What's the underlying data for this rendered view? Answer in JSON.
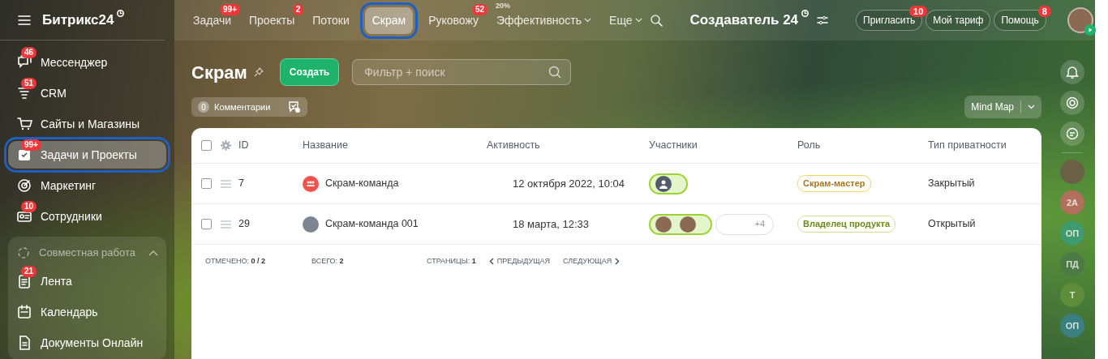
{
  "header": {
    "logo": "Битрикс24",
    "nav_tabs": [
      {
        "label": "Задачи",
        "badge": "99+",
        "selected": false,
        "dropdown": false
      },
      {
        "label": "Проекты",
        "badge": "2",
        "selected": false,
        "dropdown": false
      },
      {
        "label": "Потоки",
        "selected": false,
        "dropdown": false
      },
      {
        "label": "Скрам",
        "selected": true,
        "dropdown": false
      },
      {
        "label": "Руковожу",
        "badge": "52",
        "selected": false,
        "dropdown": false
      },
      {
        "label": "Эффективность",
        "note": "20%",
        "selected": false,
        "dropdown": true
      },
      {
        "label": "Еще",
        "selected": false,
        "dropdown": true
      }
    ],
    "portal": "Создаватель 24",
    "buttons": [
      {
        "label": "Пригласить",
        "badge": "10"
      },
      {
        "label": "Мой тариф"
      },
      {
        "label": "Помощь",
        "badge": "8"
      }
    ]
  },
  "sidebar": {
    "items": [
      {
        "label": "Мессенджер",
        "badge": "46",
        "selected": false
      },
      {
        "label": "CRM",
        "badge": "51",
        "selected": false
      },
      {
        "label": "Сайты и Магазины",
        "selected": false
      },
      {
        "label": "Задачи и Проекты",
        "badge": "99+",
        "selected": true
      },
      {
        "label": "Маркетинг",
        "selected": false
      },
      {
        "label": "Сотрудники",
        "badge": "10",
        "selected": false
      }
    ],
    "group": {
      "label": "Совместная работа",
      "expanded": true,
      "items": [
        {
          "label": "Лента",
          "badge": "21",
          "selected": false
        },
        {
          "label": "Календарь",
          "selected": false
        },
        {
          "label": "Документы Онлайн",
          "selected": false
        }
      ]
    }
  },
  "page": {
    "title": "Скрам",
    "create_button": "Создать",
    "search": {
      "placeholder": "Фильтр + поиск"
    },
    "comments": {
      "count": "0",
      "label": "Комментарии"
    },
    "view_button": "Mind Map"
  },
  "table": {
    "select_all_checked": false,
    "columns": [
      "ID",
      "Название",
      "Активность",
      "Участники",
      "Роль",
      "Тип приватности"
    ],
    "rows": [
      {
        "checked": false,
        "id": "7",
        "name": "Скрам-команда",
        "color": "#f4534c",
        "activity": "12 октября 2022, 10:04",
        "members": [
          {
            "kind": "generic"
          }
        ],
        "role": {
          "label": "Скрам-мастер",
          "color": "#f5d65a"
        },
        "privacy": "Закрытый"
      },
      {
        "checked": false,
        "id": "29",
        "name": "Скрам-команда 001",
        "color": "#7d8590",
        "activity": "18 марта, 12:33",
        "members": [
          {
            "kind": "photo"
          },
          {
            "kind": "photo"
          }
        ],
        "extra_members": "+4",
        "role": {
          "label": "Владелец продукта",
          "color": "#c8e88a"
        },
        "privacy": "Открытый"
      }
    ],
    "footer": {
      "selected_label": "ОТМЕЧЕНО:",
      "selected_value": "0 / 2",
      "total_label": "ВСЕГО:",
      "total_value": "2",
      "pages_label": "СТРАНИЦЫ:",
      "page": "1",
      "prev": "ПРЕДЫДУЩАЯ",
      "next": "СЛЕДУЮЩАЯ"
    }
  },
  "right_rail": {
    "avatars": [
      {
        "initials": "2А",
        "color": "#b0705c"
      },
      {
        "initials": "ОП",
        "color": "#3f9a70"
      },
      {
        "initials": "ПД",
        "color": "#4c7a45"
      },
      {
        "initials": "Т",
        "color": "#5e8c3a"
      },
      {
        "initials": "ОП",
        "color": "#3b7f80"
      }
    ]
  }
}
